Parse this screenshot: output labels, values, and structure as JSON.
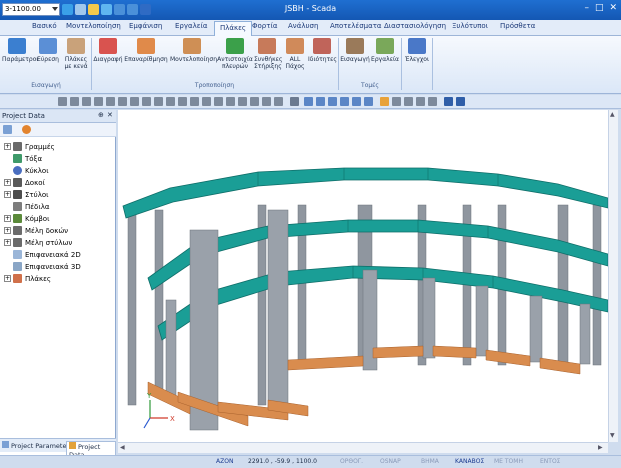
{
  "window": {
    "title": "JSBH - Scada"
  },
  "quick_access": {
    "coord_value": "3-1100.00"
  },
  "tabs": [
    "Βασικό",
    "Μοντελοποίηση",
    "Εμφάνιση",
    "Εργαλεία",
    "Πλάκες",
    "Φορτία",
    "Ανάλυση",
    "Αποτελέσματα",
    "Διαστασιολόγηση",
    "Ξυλότυποι",
    "Πρόσθετα"
  ],
  "active_tab": "Πλάκες",
  "ribbon": {
    "groups": [
      {
        "label": "Εισαγωγή",
        "buttons": [
          "Παράμετροι",
          "Εύρεση",
          "Πλάκες με κενά"
        ]
      },
      {
        "label": "Τροποποίηση",
        "buttons": [
          "Διαγραφή",
          "Επαναρίθμηση",
          "Μοντελοποίηση",
          "Αντιστοιχία πλευρών",
          "Συνθήκες Στήριξης",
          "ALL Πάχος",
          "Ιδιότητες"
        ]
      },
      {
        "label": "Τομές",
        "buttons": [
          "Εισαγωγή",
          "Εργαλεία"
        ]
      },
      {
        "label": "",
        "buttons": [
          "Έλεγχοι"
        ]
      }
    ]
  },
  "panel": {
    "title": "Project Data",
    "tree": [
      {
        "label": "Γραμμές",
        "expand": true
      },
      {
        "label": "Τόξα",
        "expand": false
      },
      {
        "label": "Κύκλοι",
        "expand": false
      },
      {
        "label": "Δοκοί",
        "expand": true
      },
      {
        "label": "Στύλοι",
        "expand": true
      },
      {
        "label": "Πέδιλα",
        "expand": false
      },
      {
        "label": "Κόμβοι",
        "expand": true
      },
      {
        "label": "Μέλη δοκών",
        "expand": true
      },
      {
        "label": "Μέλη στύλων",
        "expand": true
      },
      {
        "label": "Επιφανειακά 2D",
        "expand": false
      },
      {
        "label": "Επιφανειακά 3D",
        "expand": false
      },
      {
        "label": "Πλάκες",
        "expand": true
      }
    ],
    "bottom_tabs": [
      "Project Parameter",
      "Project Data"
    ]
  },
  "status": {
    "items": [
      "ΑΖΟΝ",
      "2291.0 , -59.9 , 1100.0",
      "ΟΡΘΟΓ.",
      "OSNAP",
      "ΒΗΜΑ",
      "ΚΑΝΑΒΟΣ",
      "ΜΕ ΤΟΜΗ",
      "ΕΝΤΟΣ"
    ]
  },
  "axis": {
    "x": "X",
    "y": "Y"
  },
  "colors": {
    "slab": "#1a9e96",
    "slab_edge": "#0f6e69",
    "column": "#8f969f",
    "beam": "#d98c4e"
  }
}
